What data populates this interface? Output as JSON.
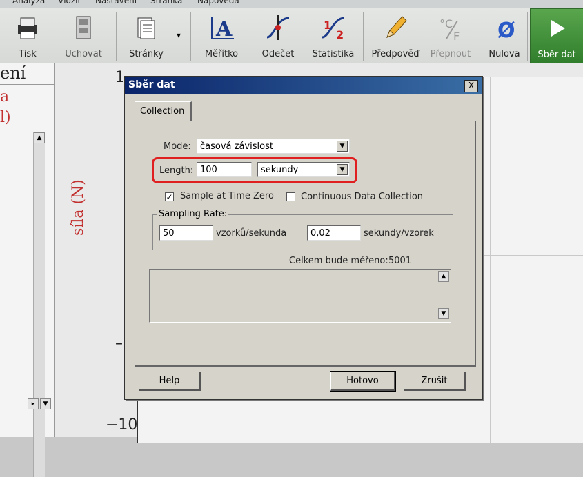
{
  "menubar": {
    "items": [
      "Analýza",
      "Vložit",
      "Nastavení",
      "Stránka",
      "Nápověda"
    ]
  },
  "toolbar": {
    "buttons": [
      {
        "label": "Tisk",
        "icon": "printer-icon"
      },
      {
        "label": "Uchovat",
        "icon": "store-icon"
      },
      {
        "label": "Stránky",
        "icon": "pages-icon"
      },
      {
        "label": "Měřítko",
        "icon": "autoscale-icon"
      },
      {
        "label": "Odečet",
        "icon": "examine-icon"
      },
      {
        "label": "Statistika",
        "icon": "statistics-icon"
      },
      {
        "label": "Předpověď",
        "icon": "prediction-pencil-icon"
      },
      {
        "label": "Přepnout",
        "icon": "switch-units-icon"
      },
      {
        "label": "Nulova",
        "icon": "zero-icon"
      },
      {
        "label": "Sběr dat",
        "icon": "collect-play-icon"
      }
    ],
    "pages_dropdown_glyph": "▾"
  },
  "background": {
    "left_header": "ení",
    "left_sub1": "a",
    "left_sub2": "l)",
    "y_axis_label": "síla (N)",
    "y_tick_top": "1",
    "y_tick_bottom": "−10",
    "y_tick_mid": "–"
  },
  "dialog": {
    "title": "Sběr dat",
    "close_glyph": "X",
    "tab": "Collection",
    "mode_label": "Mode:",
    "mode_value": "časová závislost",
    "length_label": "Length:",
    "length_value": "100",
    "length_unit": "sekundy",
    "sample_at_zero_label": "Sample at Time Zero",
    "sample_at_zero_checked": true,
    "continuous_label": "Continuous Data Collection",
    "continuous_checked": false,
    "sampling_rate_title": "Sampling Rate:",
    "rate_value": "50",
    "rate_unit": "vzorků/sekunda",
    "interval_value": "0,02",
    "interval_unit": "sekundy/vzorek",
    "total_label": "Celkem bude měřeno:",
    "total_value": "5001",
    "help_button": "Help",
    "ok_button": "Hotovo",
    "cancel_button": "Zrušit"
  },
  "colors": {
    "title_bar": "#0a246a",
    "highlight": "#e02020",
    "axis_label": "#c23030",
    "collect": "#3f8f36"
  }
}
